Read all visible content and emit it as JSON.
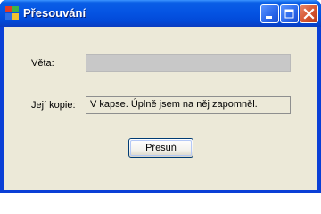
{
  "window": {
    "title": "Přesouvání",
    "icon": "app-icon",
    "controls": [
      "minimize-icon",
      "maximize-icon",
      "close-icon"
    ]
  },
  "form": {
    "veta_label": "Věta:",
    "veta_value": "",
    "kopie_label": "Její kopie:",
    "kopie_value": "V kapse. Úplně jsem na něj zapomněl.",
    "button_label": "Přesuň"
  },
  "colors": {
    "titlebar": "#0554e3",
    "client": "#ece9d8",
    "close_button": "#d5542f",
    "disabled_field": "#c8c8c8"
  }
}
